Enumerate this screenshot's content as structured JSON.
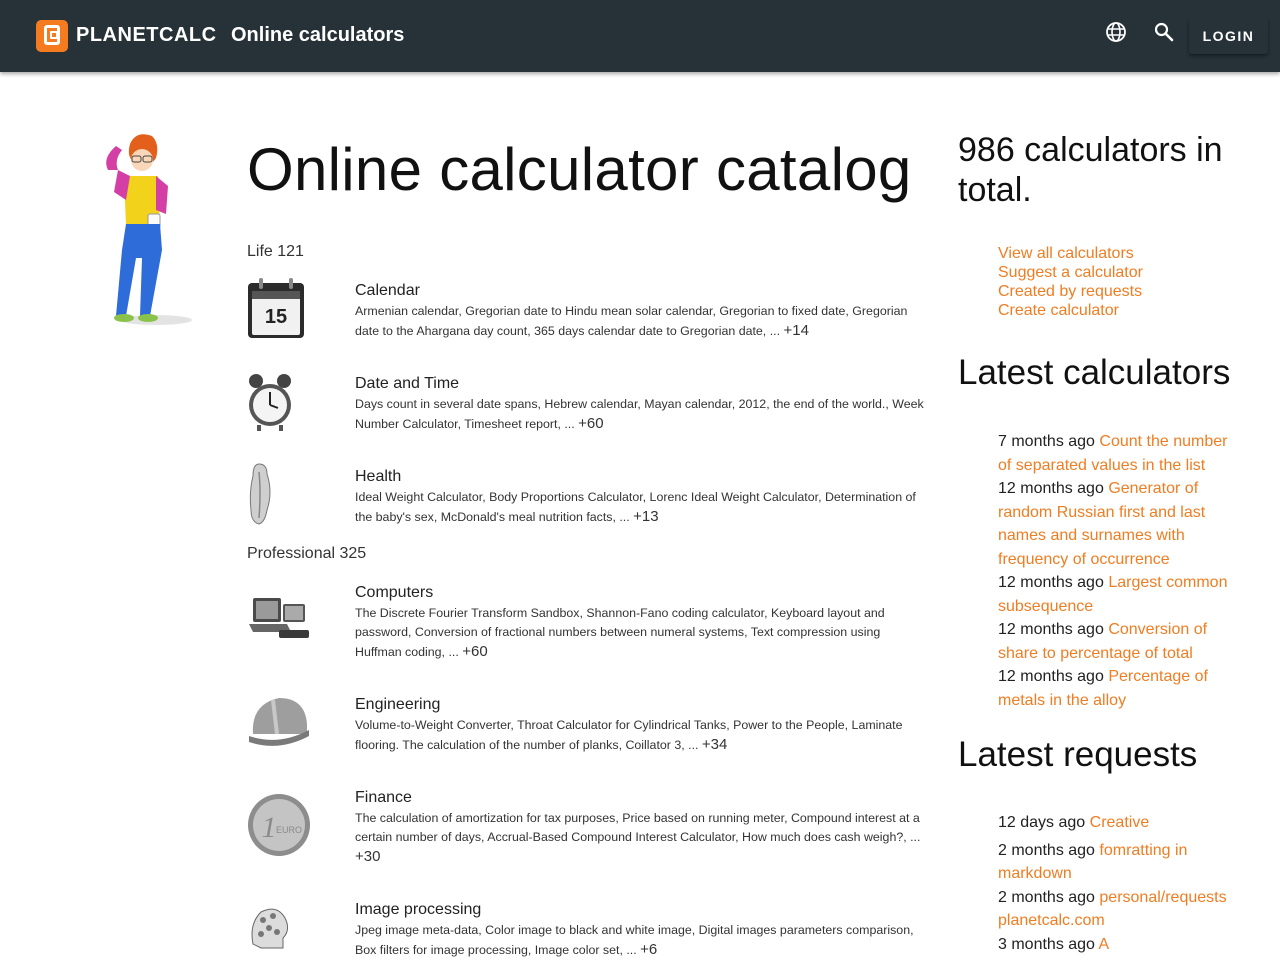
{
  "header": {
    "brand": "PLANETCALC",
    "section": "Online calculators",
    "login": "LOGIN",
    "icons": [
      "language-icon",
      "search-icon"
    ],
    "background": "#263238",
    "accent": "#f47b20"
  },
  "main": {
    "title": "Online calculator catalog",
    "groups": [
      {
        "label": "Life 121",
        "categories": [
          {
            "name": "Calendar",
            "desc": "Armenian calendar,   Gregorian date to Hindu mean solar calendar,   Gregorian to fixed date,   Gregorian date to the Ahargana day count,   365 days calendar date to Gregorian date, ...",
            "more": "+14"
          },
          {
            "name": "Date and Time",
            "desc": "Days count in several date spans,   Hebrew calendar,   Mayan calendar, 2012, the end of the world.,   Week Number Calculator,   Timesheet report, ...",
            "more": "+60"
          },
          {
            "name": "Health",
            "desc": "Ideal Weight Calculator,   Body Proportions Calculator,   Lorenc Ideal Weight Calculator,   Determination of the baby's sex,   McDonald's meal nutrition facts, ...",
            "more": "+13"
          }
        ]
      },
      {
        "label": "Professional 325",
        "categories": [
          {
            "name": "Computers",
            "desc": "The Discrete Fourier Transform Sandbox,   Shannon-Fano coding calculator,   Keyboard layout and password,   Conversion of fractional numbers between numeral systems,   Text compression using Huffman coding, ...",
            "more": "+60"
          },
          {
            "name": "Engineering",
            "desc": "Volume-to-Weight Converter,   Throat Calculator for Cylindrical Tanks,   Power to the People,   Laminate flooring. The calculation of the number of planks,   Coillator 3, ...",
            "more": "+34"
          },
          {
            "name": "Finance",
            "desc": "The calculation of amortization for tax purposes,   Price based on running meter,   Compound interest at a certain number of days,   Accrual-Based Compound Interest Calculator,   How much does cash weigh?, ...",
            "more": "+30"
          },
          {
            "name": "Image processing",
            "desc": "Jpeg image meta-data,   Color image to black and white image,   Digital images parameters comparison,   Box filters for image processing,   Image color set, ...",
            "more": "+6"
          }
        ]
      }
    ]
  },
  "sidebar": {
    "count_title": "986 calculators in total.",
    "links": [
      "View all calculators",
      "Suggest a calculator",
      "Created by requests",
      "Create calculator"
    ],
    "latest_calculators_title": "Latest calculators",
    "latest_calculators": [
      {
        "ago": "7 months ago",
        "title": "Count the number of separated values in the list"
      },
      {
        "ago": "12 months ago",
        "title": "Generator of random Russian first and last names and surnames with frequency of occurrence"
      },
      {
        "ago": "12 months ago",
        "title": "Largest common subsequence"
      },
      {
        "ago": "12 months ago",
        "title": "Conversion of share to percentage of total"
      },
      {
        "ago": "12 months ago",
        "title": "Percentage of metals in the alloy"
      }
    ],
    "latest_requests_title": "Latest requests",
    "latest_requests": [
      {
        "ago": "12 days ago",
        "title": "Creative"
      },
      {
        "ago": "2 months ago",
        "title": "fomratting in markdown"
      },
      {
        "ago": "2 months ago",
        "title": "personal/requests planetcalc.com"
      },
      {
        "ago": "3 months ago",
        "title": "A"
      }
    ],
    "link_color": "#ef7d22"
  }
}
